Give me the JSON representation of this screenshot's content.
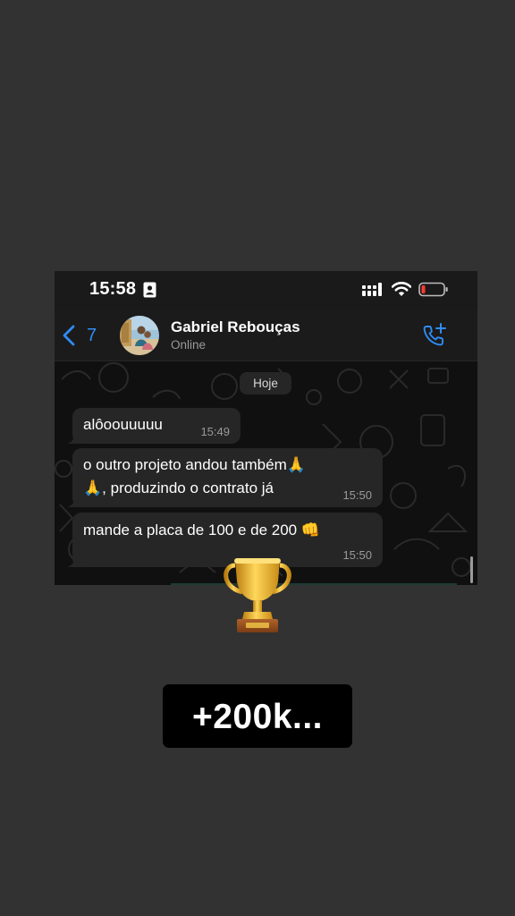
{
  "status_bar": {
    "time": "15:58",
    "icons": [
      "contact-card-icon",
      "signal-icon",
      "wifi-icon",
      "battery-low-icon"
    ]
  },
  "header": {
    "back_count": "7",
    "contact_name": "Gabriel Rebouças",
    "contact_status": "Online",
    "accent_color": "#2f8cf5",
    "icons": [
      "chevron-left-icon",
      "avatar",
      "phone-add-icon"
    ]
  },
  "chat": {
    "date_label": "Hoje",
    "messages": [
      {
        "line1": "alôoouuuuu",
        "line2": "",
        "time": "15:49"
      },
      {
        "line1": "o outro projeto andou também🙏",
        "line2": "🙏, produzindo o contrato já",
        "time": "15:50"
      },
      {
        "line1": "mande a placa de 100 e de 200 👊",
        "line2": "",
        "time": "15:50"
      }
    ],
    "bubble_color": "#262626"
  },
  "overlay": {
    "icon": "trophy-icon",
    "caption": "+200k..."
  }
}
